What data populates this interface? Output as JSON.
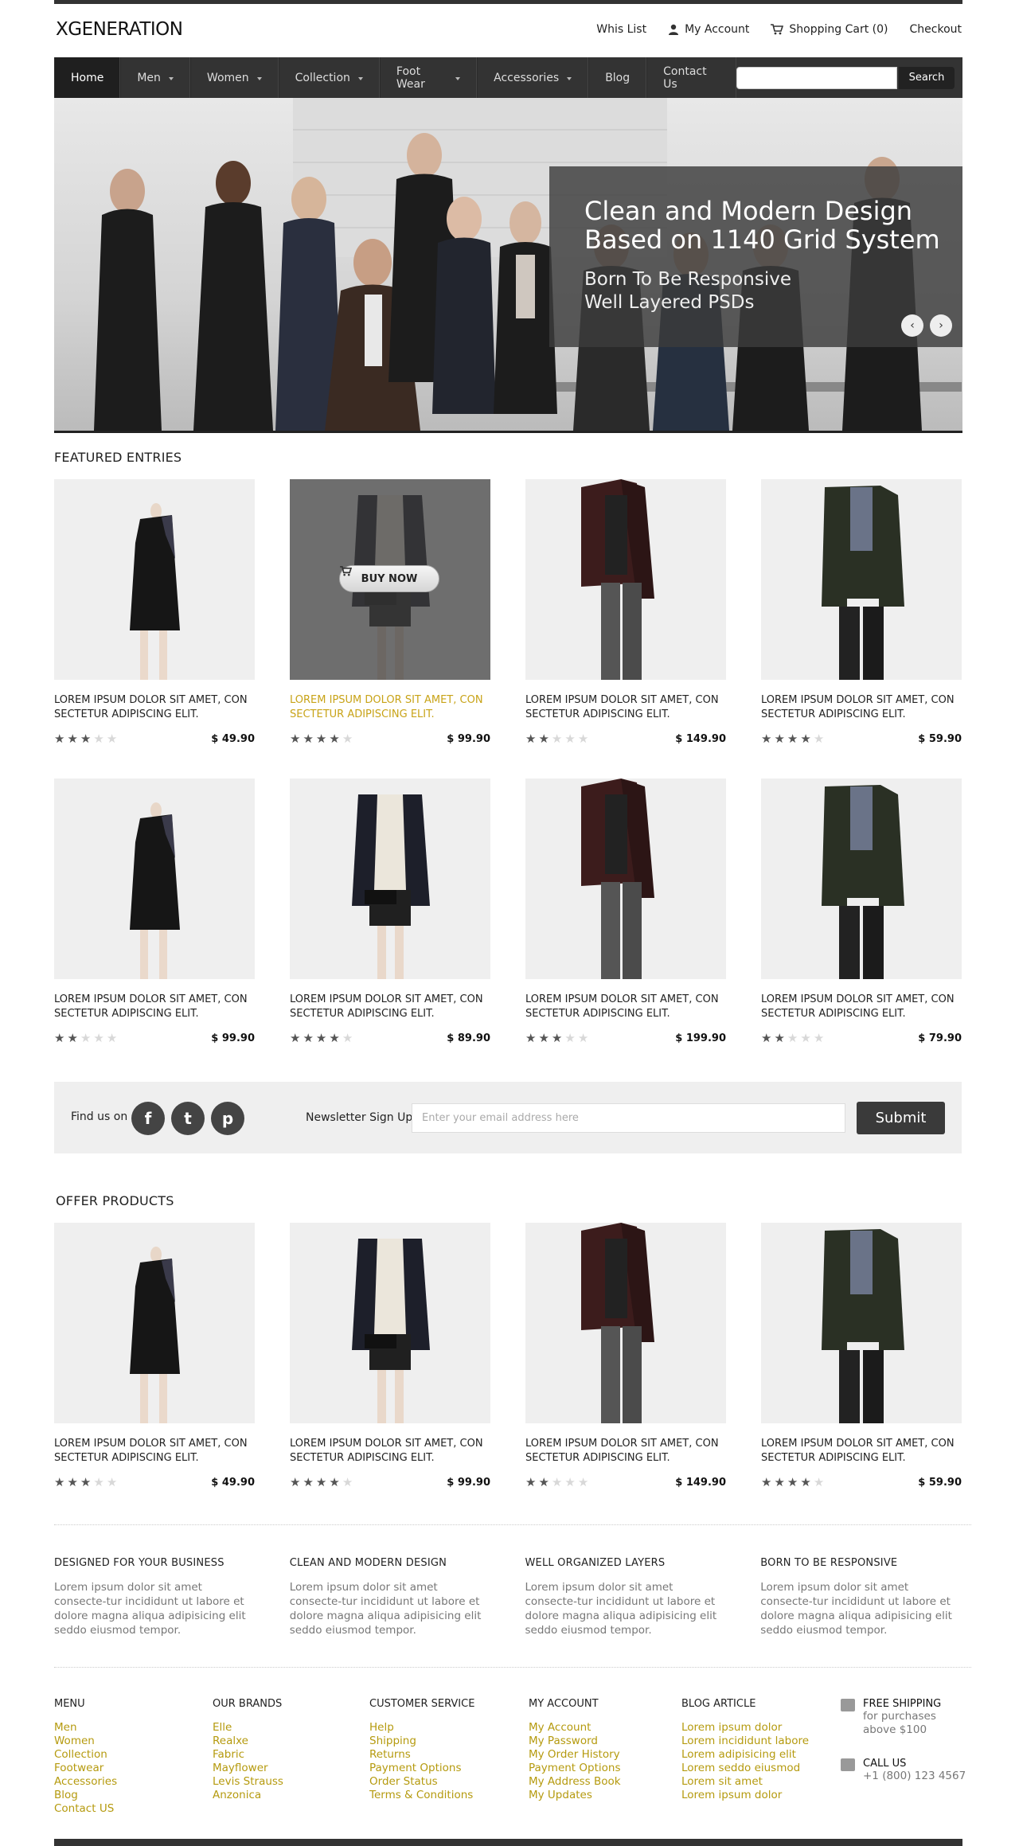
{
  "brand": {
    "logo": "XGENERATION"
  },
  "toplinks": {
    "wishlist": "Whis List",
    "account": "My Account",
    "cart": "Shopping Cart (0)",
    "checkout": "Checkout"
  },
  "nav": {
    "items": [
      "Home",
      "Men",
      "Women",
      "Collection",
      "Foot Wear",
      "Accessories",
      "Blog",
      "Contact Us"
    ],
    "search_placeholder": "",
    "search_button": "Search"
  },
  "hero": {
    "headline_1": "Clean and Modern Design",
    "headline_2": "Based on 1140 Grid System",
    "sub_1": "Born To Be Responsive",
    "sub_2": "Well Layered PSDs",
    "prev": "‹",
    "next": "›"
  },
  "featured": {
    "title": "FEATURED ENTRIES",
    "buy_now": "BUY NOW",
    "products": [
      {
        "title": "LOREM IPSUM DOLOR SIT AMET, CON SECTETUR ADIPISCING ELIT.",
        "price": "$ 49.90",
        "rating": 3,
        "kind": "dress"
      },
      {
        "title": "LOREM IPSUM DOLOR SIT AMET, CON SECTETUR ADIPISCING ELIT.",
        "price": "$ 99.90",
        "rating": 4,
        "kind": "blazer",
        "hover": true
      },
      {
        "title": "LOREM IPSUM DOLOR SIT AMET, CON SECTETUR ADIPISCING ELIT.",
        "price": "$ 149.90",
        "rating": 2,
        "kind": "leather"
      },
      {
        "title": "LOREM IPSUM DOLOR SIT AMET, CON SECTETUR ADIPISCING ELIT.",
        "price": "$ 59.90",
        "rating": 4,
        "kind": "jacket"
      },
      {
        "title": "LOREM IPSUM DOLOR SIT AMET, CON SECTETUR ADIPISCING ELIT.",
        "price": "$ 99.90",
        "rating": 2,
        "kind": "dress"
      },
      {
        "title": "LOREM IPSUM DOLOR SIT AMET, CON SECTETUR ADIPISCING ELIT.",
        "price": "$ 89.90",
        "rating": 4,
        "kind": "blazer"
      },
      {
        "title": "LOREM IPSUM DOLOR SIT AMET, CON SECTETUR ADIPISCING ELIT.",
        "price": "$ 199.90",
        "rating": 3,
        "kind": "leather"
      },
      {
        "title": "LOREM IPSUM DOLOR SIT AMET, CON SECTETUR ADIPISCING ELIT.",
        "price": "$ 79.90",
        "rating": 2,
        "kind": "jacket"
      }
    ]
  },
  "social": {
    "find_us": "Find us on",
    "icons": [
      "facebook-icon",
      "twitter-icon",
      "pinterest-icon"
    ],
    "newsletter_label": "Newsletter Sign Up",
    "email_placeholder": "Enter your email address here",
    "submit": "Submit"
  },
  "offers": {
    "title": "OFFER PRODUCTS",
    "products": [
      {
        "title": "LOREM IPSUM DOLOR SIT AMET, CON SECTETUR ADIPISCING ELIT.",
        "price": "$ 49.90",
        "rating": 3,
        "kind": "dress"
      },
      {
        "title": "LOREM IPSUM DOLOR SIT AMET, CON SECTETUR ADIPISCING ELIT.",
        "price": "$ 99.90",
        "rating": 4,
        "kind": "blazer"
      },
      {
        "title": "LOREM IPSUM DOLOR SIT AMET, CON SECTETUR ADIPISCING ELIT.",
        "price": "$ 149.90",
        "rating": 2,
        "kind": "leather"
      },
      {
        "title": "LOREM IPSUM DOLOR SIT AMET, CON SECTETUR ADIPISCING ELIT.",
        "price": "$ 59.90",
        "rating": 4,
        "kind": "jacket"
      }
    ]
  },
  "features": [
    {
      "title": "DESIGNED FOR YOUR BUSINESS",
      "text": "Lorem ipsum dolor sit amet consecte-tur incididunt ut labore et dolore magna aliqua adipisicing elit seddo eiusmod tempor."
    },
    {
      "title": "CLEAN AND MODERN DESIGN",
      "text": "Lorem ipsum dolor sit amet consecte-tur incididunt ut labore et dolore magna aliqua adipisicing elit seddo eiusmod tempor."
    },
    {
      "title": "WELL ORGANIZED LAYERS",
      "text": "Lorem ipsum dolor sit amet consecte-tur incididunt ut labore et dolore magna aliqua adipisicing elit seddo eiusmod tempor."
    },
    {
      "title": "BORN TO BE RESPONSIVE",
      "text": "Lorem ipsum dolor sit amet consecte-tur incididunt ut labore et dolore magna aliqua adipisicing elit seddo eiusmod tempor."
    }
  ],
  "footer": {
    "columns": [
      {
        "title": "MENU",
        "links": [
          "Men",
          "Women",
          "Collection",
          "Footwear",
          "Accessories",
          "Blog",
          "Contact US"
        ]
      },
      {
        "title": "OUR BRANDS",
        "links": [
          "Elle",
          "Realxe",
          "Fabric",
          "Mayflower",
          "Levis Strauss",
          "Anzonica"
        ]
      },
      {
        "title": "CUSTOMER SERVICE",
        "links": [
          "Help",
          "Shipping",
          "Returns",
          "Payment Options",
          "Order Status",
          "Terms & Conditions"
        ]
      },
      {
        "title": "MY ACCOUNT",
        "links": [
          "My Account",
          "My Password",
          "My Order History",
          "Payment Options",
          "My Address Book",
          "My Updates"
        ]
      },
      {
        "title": "BLOG ARTICLE",
        "links": [
          "Lorem ipsum dolor",
          "Lorem incididunt labore",
          "Lorem adipisicing elit",
          "Lorem seddo eiusmod",
          "Lorem sit amet",
          "Lorem ipsum dolor"
        ]
      }
    ],
    "shipping_title": "FREE SHIPPING",
    "shipping_line1": "for purchases",
    "shipping_line2": "above $100",
    "call_title": "CALL US",
    "call_number": "+1 (800) 123 4567"
  },
  "colors": {
    "accent": "#b59a0e",
    "nav": "#333333",
    "panel": "#efefef"
  }
}
